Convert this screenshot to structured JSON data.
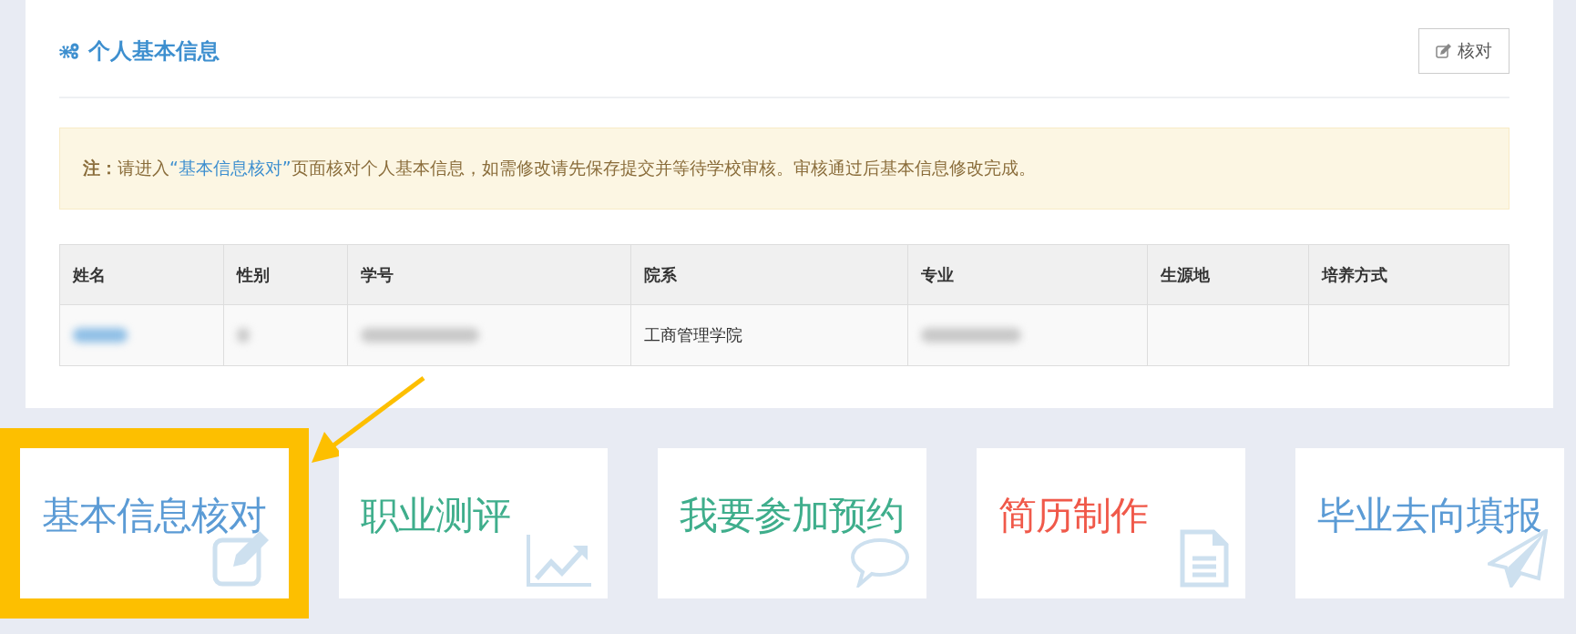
{
  "panel": {
    "title": "个人基本信息",
    "check_button": "核对",
    "notice": {
      "label": "注：",
      "before": "请进入",
      "link": "“基本信息核对”",
      "after": "页面核对个人基本信息，如需修改请先保存提交并等待学校审核。审核通过后基本信息修改完成。"
    },
    "table": {
      "columns": [
        "姓名",
        "性别",
        "学号",
        "院系",
        "专业",
        "生源地",
        "培养方式"
      ],
      "rows": [
        [
          {
            "kind": "blurred-link"
          },
          {
            "kind": "blurred"
          },
          {
            "kind": "blurred"
          },
          {
            "kind": "text",
            "text": "工商管理学院"
          },
          {
            "kind": "blurred"
          },
          {
            "kind": "empty"
          },
          {
            "kind": "empty"
          }
        ]
      ]
    }
  },
  "tiles": [
    {
      "label": "基本信息核对",
      "color": "#5b9bd5",
      "highlighted": true
    },
    {
      "label": "职业测评",
      "color": "#3fae8c",
      "highlighted": false
    },
    {
      "label": "我要参加预约",
      "color": "#3fae8c",
      "highlighted": false
    },
    {
      "label": "简历制作",
      "color": "#f0594a",
      "highlighted": false
    },
    {
      "label": "毕业去向填报",
      "color": "#5b9bd5",
      "highlighted": false
    }
  ]
}
